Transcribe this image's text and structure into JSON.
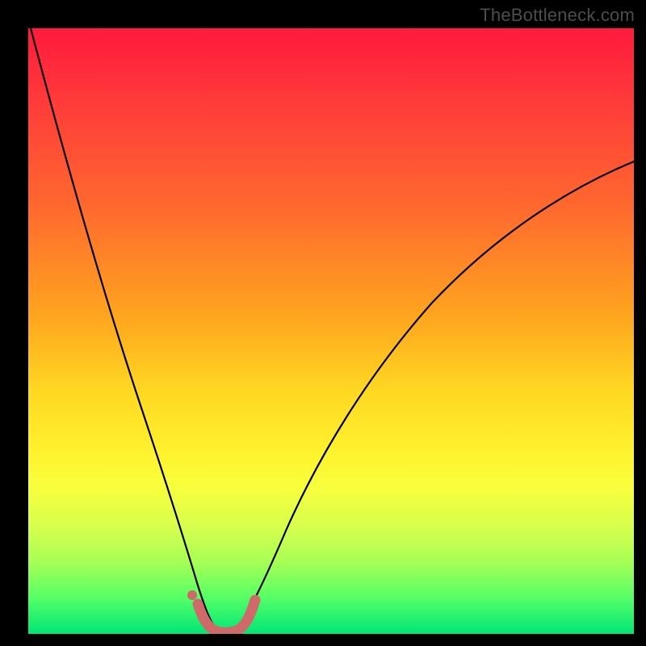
{
  "attribution": "TheBottleneck.com",
  "colors": {
    "frame": "#000000",
    "gradient_top": "#ff1a3d",
    "gradient_mid": "#fff22e",
    "gradient_bottom": "#00e676",
    "curve_stroke": "#000000",
    "highlight_stroke": "#cf6a6a"
  },
  "chart_data": {
    "type": "line",
    "title": "",
    "xlabel": "",
    "ylabel": "",
    "xlim": [
      0,
      100
    ],
    "ylim": [
      0,
      100
    ],
    "grid": false,
    "legend": false,
    "annotations": [
      "TheBottleneck.com"
    ],
    "series": [
      {
        "name": "curve",
        "x": [
          0,
          5,
          10,
          15,
          20,
          23,
          26,
          28,
          29,
          30,
          31,
          32,
          33,
          35,
          38,
          42,
          47,
          53,
          60,
          68,
          77,
          87,
          100
        ],
        "y": [
          100,
          80,
          58,
          37,
          18,
          8,
          3,
          1,
          0.3,
          0,
          0,
          0.3,
          1,
          3,
          8,
          16,
          26,
          36,
          46,
          55,
          63,
          70,
          78
        ]
      },
      {
        "name": "highlight-band",
        "x": [
          27,
          28,
          29,
          30,
          31,
          32,
          33
        ],
        "y": [
          2.5,
          1,
          0.3,
          0,
          0,
          0.3,
          2.5
        ]
      },
      {
        "name": "highlight-dot",
        "x": [
          26.5
        ],
        "y": [
          4
        ]
      }
    ]
  }
}
